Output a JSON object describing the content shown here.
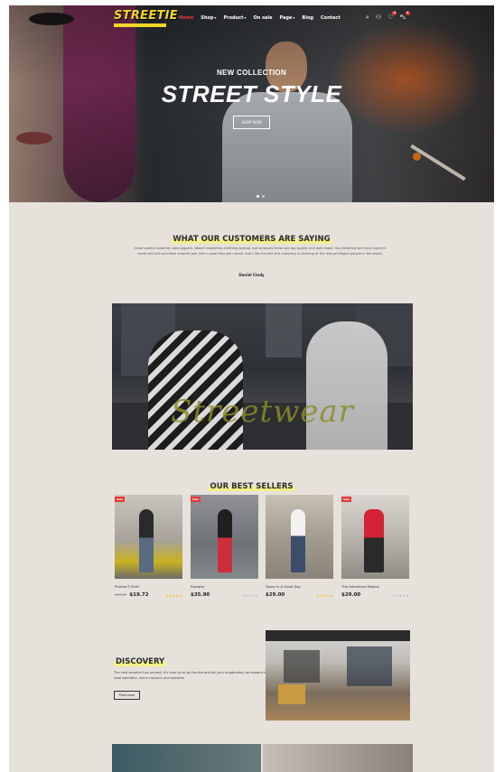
{
  "brand": {
    "logo_text": "STREETIE"
  },
  "nav": {
    "items": [
      {
        "label": "Home",
        "active": true,
        "caret": false
      },
      {
        "label": "Shop",
        "active": false,
        "caret": true
      },
      {
        "label": "Product",
        "active": false,
        "caret": true
      },
      {
        "label": "On sale",
        "active": false,
        "caret": false
      },
      {
        "label": "Page",
        "active": false,
        "caret": true
      },
      {
        "label": "Blog",
        "active": false,
        "caret": false
      },
      {
        "label": "Contact",
        "active": false,
        "caret": false
      }
    ],
    "icons": [
      "search-icon",
      "user-icon",
      "heart-icon",
      "cart-icon"
    ],
    "wishlist_count": "0",
    "cart_count": "0"
  },
  "hero": {
    "subtitle": "NEW COLLECTION",
    "title": "STREET STYLE",
    "button": "SHOP NOW",
    "slides": 2,
    "active_slide": 0
  },
  "testimonials": {
    "title": "WHAT OUR CUSTOMERS ARE SAYING",
    "quote": "Great quality material, solid joggers. Wasn't expecting anything special, but seriously these are top quality and well made. You definitely get your money's worth and will purchase another pair just in case they get ruined. And I like the fact this company is thinking of the less privileged people in the world.",
    "author": "Daniel Cindy"
  },
  "banner": {
    "script_text": "Streetwear"
  },
  "best_sellers": {
    "title": "OUR BEST SELLERS",
    "products": [
      {
        "name": "Printed T-Shirt",
        "price": "$19.72",
        "old_price": "$25.00",
        "sale": "Sale",
        "rating": 5
      },
      {
        "name": "Sweater",
        "price": "$35.90",
        "old_price": "",
        "sale": "Sale",
        "rating": 0
      },
      {
        "name": "Today Is A Good Day",
        "price": "$29.00",
        "old_price": "",
        "sale": "",
        "rating": 4
      },
      {
        "name": "The Adventure Begins",
        "price": "$29.00",
        "old_price": "",
        "sale": "Sale",
        "rating": 0
      }
    ]
  },
  "discovery": {
    "title": "DISCOVERY",
    "text": "The cold weather has arrived, it's time to sit by the fire and let your imagination go forward in wool sweaters, warm trousers and leotards.",
    "button": "Find more"
  },
  "colors": {
    "accent": "#e53935",
    "highlight": "#f4ef8a",
    "logo": "#f2d629",
    "page_bg": "#e6e1da"
  }
}
